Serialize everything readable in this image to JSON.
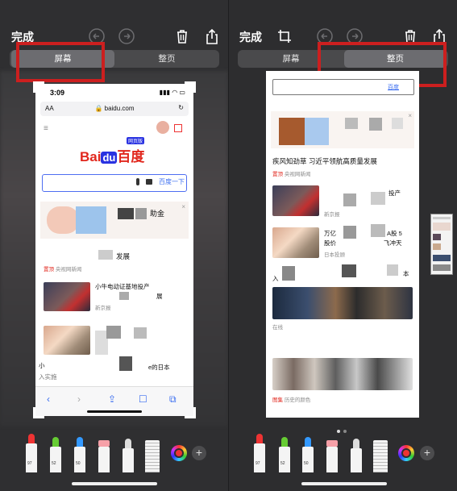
{
  "left_panel": {
    "done_label": "完成",
    "tabs": [
      "屏幕",
      "整页"
    ],
    "selected_tab": "屏幕",
    "screenshot": {
      "status_time": "3:09",
      "address_aa": "AA",
      "url": "baidu.com",
      "logo_bai": "Bai",
      "logo_du": "du",
      "logo_zh": "百度",
      "logo_tag": "网页版",
      "search_button": "百度一下",
      "banner_text": "助金",
      "news_headline_1": "发展",
      "news_source_1_tag": "置顶",
      "news_source_1": "央视网新闻",
      "news_item_2_text": "小牛电动证基地投产",
      "news_item_2_extra": "展",
      "news_item_2_source": "新京报",
      "news_item_3_text": "e的日本",
      "news_item_3_sub": "入实施",
      "news_item_3_prefix": "小"
    }
  },
  "right_panel": {
    "done_label": "完成",
    "tabs": [
      "屏幕",
      "整页"
    ],
    "selected_tab": "整页",
    "page": {
      "top_link": "百度",
      "headline": "疾风知劲草 习近平领航高质量发展",
      "headline_source_tag": "置顶",
      "headline_source": "央视网新闻",
      "item_1_text": "投产",
      "item_1_source": "新京报",
      "item_2_title_a": "万亿",
      "item_2_title_b": "A股 5",
      "item_2_title_c": "股价",
      "item_2_title_d": "飞冲天",
      "item_2_source": "日本投顾",
      "item_3_text": "本",
      "item_3_prefix": "入",
      "item_3_source": "在线",
      "item_4_source_tag": "图集",
      "item_4_source": "历史的颜色"
    }
  },
  "toolbar": {
    "pen_labels": [
      "97",
      "52",
      "50"
    ],
    "add_label": "+"
  },
  "colors": {
    "annotation_red": "#cc1f1f",
    "baidu_red": "#e1271d",
    "baidu_blue": "#2932e1",
    "link_blue": "#3a6df0"
  }
}
